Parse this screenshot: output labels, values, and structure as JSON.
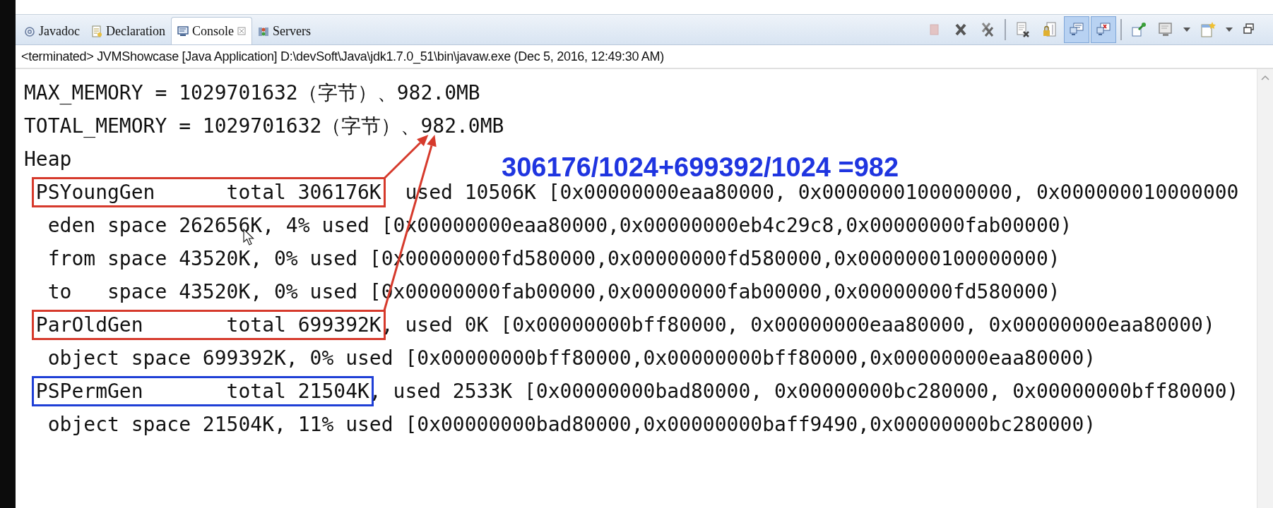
{
  "tabs": [
    {
      "label": "Javadoc",
      "kind": "javadoc",
      "selected": false
    },
    {
      "label": "Declaration",
      "kind": "declaration",
      "selected": false
    },
    {
      "label": "Console",
      "kind": "console",
      "selected": true
    },
    {
      "label": "Servers",
      "kind": "servers",
      "selected": false
    }
  ],
  "toolbar": [
    {
      "kind": "stop"
    },
    {
      "kind": "remove"
    },
    {
      "kind": "remove-all"
    },
    {
      "kind": "separator"
    },
    {
      "kind": "clear"
    },
    {
      "kind": "scroll-lock"
    },
    {
      "kind": "show-out",
      "pressed": true
    },
    {
      "kind": "show-err",
      "pressed": true
    },
    {
      "kind": "separator"
    },
    {
      "kind": "pin"
    },
    {
      "kind": "display"
    },
    {
      "kind": "dropdown"
    },
    {
      "kind": "new-console"
    },
    {
      "kind": "dropdown"
    },
    {
      "kind": "minimize"
    }
  ],
  "status_line": "<terminated> JVMShowcase [Java Application] D:\\devSoft\\Java\\jdk1.7.0_51\\bin\\javaw.exe (Dec 5, 2016, 12:49:30 AM)",
  "console": {
    "lines": [
      {
        "segments": [
          {
            "text": "MAX_MEMORY = 1029701632（字节）、982.0MB"
          }
        ]
      },
      {
        "segments": [
          {
            "text": "TOTAL_MEMORY = 1029701632（字节）、982.0MB"
          }
        ]
      },
      {
        "segments": [
          {
            "text": "Heap"
          }
        ]
      },
      {
        "segments": [
          {
            "text": "PSYoungGen      total 306176K",
            "color": "#d63a2c",
            "arrow": true
          },
          {
            "text": "  used 10506K [0x00000000eaa80000, 0x0000000100000000, 0x000000010000000"
          }
        ]
      },
      {
        "segments": [
          {
            "text": "  eden space 262656K, 4% used [0x00000000eaa80000,0x00000000eb4c29c8,0x00000000fab00000)"
          }
        ]
      },
      {
        "segments": [
          {
            "text": "  from space 43520K, 0% used [0x00000000fd580000,0x00000000fd580000,0x0000000100000000)"
          }
        ]
      },
      {
        "segments": [
          {
            "text": "  to   space 43520K, 0% used [0x00000000fab00000,0x00000000fab00000,0x00000000fd580000)"
          }
        ]
      },
      {
        "segments": [
          {
            "text": "ParOldGen       total 699392K",
            "color": "#d63a2c",
            "arrow": true
          },
          {
            "text": ", used 0K [0x00000000bff80000, 0x00000000eaa80000, 0x00000000eaa80000)"
          }
        ]
      },
      {
        "segments": [
          {
            "text": "  object space 699392K, 0% used [0x00000000bff80000,0x00000000bff80000,0x00000000eaa80000)"
          }
        ]
      },
      {
        "segments": [
          {
            "text": "PSPermGen       total 21504K",
            "color": "#1f3fd6",
            "arrow": false
          },
          {
            "text": ", used 2533K [0x00000000bad80000, 0x00000000bc280000, 0x00000000bff80000)"
          }
        ]
      },
      {
        "segments": [
          {
            "text": "  object space 21504K, 11% used [0x00000000bad80000,0x00000000baff9490,0x00000000bc280000)"
          }
        ]
      }
    ],
    "annotation": "306176/1024+699392/1024 =982"
  }
}
